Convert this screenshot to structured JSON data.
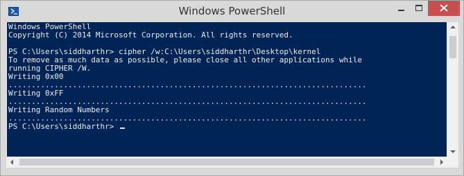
{
  "window": {
    "title": "Windows PowerShell",
    "icon": "powershell-icon"
  },
  "controls": {
    "minimize_icon": "minimize-icon",
    "maximize_icon": "maximize-icon",
    "close_icon": "close-icon",
    "close_color": "#c7504e"
  },
  "console": {
    "background": "#012456",
    "foreground": "#eeedf0",
    "lines": [
      "Windows PowerShell",
      "Copyright (C) 2014 Microsoft Corporation. All rights reserved.",
      "",
      "PS C:\\Users\\siddharthr> cipher /w:C:\\Users\\siddharthr\\Desktop\\kernel",
      "To remove as much data as possible, please close all other applications while",
      "running CIPHER /W.",
      "Writing 0x00",
      "..............................................................................",
      "Writing 0xFF",
      "..............................................................................",
      "Writing Random Numbers",
      "..............................................................................",
      "PS C:\\Users\\siddharthr> "
    ]
  }
}
